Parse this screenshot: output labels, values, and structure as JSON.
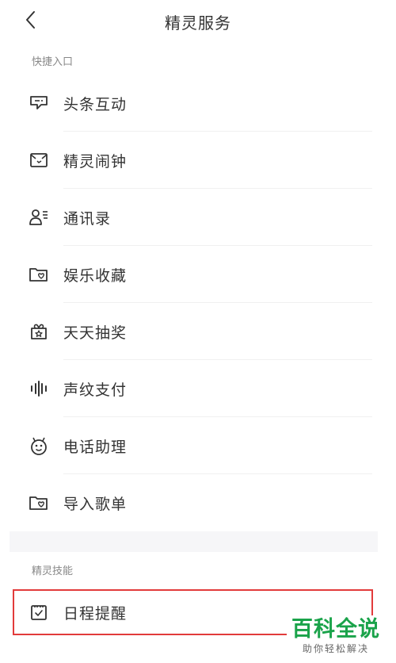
{
  "header": {
    "title": "精灵服务"
  },
  "sections": {
    "shortcuts": "快捷入口",
    "skills": "精灵技能"
  },
  "shortcuts": [
    {
      "label": "头条互动",
      "icon": "message-icon"
    },
    {
      "label": "精灵闹钟",
      "icon": "alarm-box-icon"
    },
    {
      "label": "通讯录",
      "icon": "contacts-icon"
    },
    {
      "label": "娱乐收藏",
      "icon": "heart-folder-icon"
    },
    {
      "label": "天天抽奖",
      "icon": "gift-star-icon"
    },
    {
      "label": "声纹支付",
      "icon": "voiceprint-icon"
    },
    {
      "label": "电话助理",
      "icon": "robot-face-icon"
    },
    {
      "label": "导入歌单",
      "icon": "heart-folder-icon"
    }
  ],
  "skills": [
    {
      "label": "日程提醒",
      "icon": "calendar-check-icon"
    }
  ],
  "watermark": {
    "main": "百科全说",
    "sub": "助你轻松解决"
  },
  "colors": {
    "highlight": "#e23b3b",
    "watermark": "#1aa34a"
  }
}
